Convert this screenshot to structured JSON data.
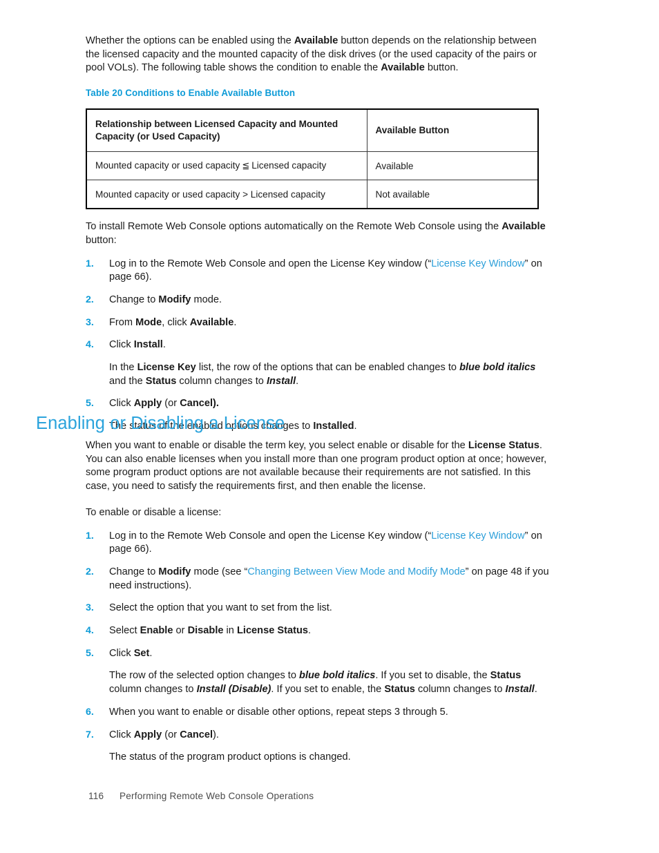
{
  "document": {
    "intro_paragraph": {
      "seg1": "Whether the options can be enabled using the ",
      "bold1": "Available",
      "seg2": " button depends on the relationship between the licensed capacity and the mounted capacity of the disk drives (or the used capacity of the pairs or pool VOLs). The following table shows the condition to enable the ",
      "bold2": "Available",
      "seg3": " button."
    },
    "table_caption": "Table 20 Conditions to Enable Available Button",
    "table": {
      "headers": [
        "Relationship between Licensed Capacity and Mounted Capacity (or Used Capacity)",
        "Available Button"
      ],
      "rows": [
        {
          "condition_pre": "Mounted capacity or used capacity",
          "operator": "≦",
          "condition_post": "Licensed capacity",
          "result": "Available"
        },
        {
          "condition_pre": "Mounted capacity or used capacity > Licensed capacity",
          "operator": "",
          "condition_post": "",
          "result": "Not available"
        }
      ]
    },
    "install_intro": {
      "seg1": "To install Remote Web Console options automatically on the Remote Web Console using the ",
      "bold1": "Available",
      "seg2": " button:"
    },
    "install_steps": [
      {
        "num": "1.",
        "seg1": "Log in to the Remote Web Console and open the License Key window (“",
        "link": "License Key Window",
        "seg2": "” on page 66)."
      },
      {
        "num": "2.",
        "seg1": "Change to ",
        "bold1": "Modify",
        "seg2": " mode."
      },
      {
        "num": "3.",
        "seg1": "From ",
        "bold1": "Mode",
        "seg2": ", click ",
        "bold2": "Available",
        "seg3": "."
      },
      {
        "num": "4.",
        "seg1": "Click ",
        "bold1": "Install",
        "seg2": ".",
        "sub": {
          "s1": "In the ",
          "b1": "License Key",
          "s2": " list, the row of the options that can be enabled changes to ",
          "bi1": "blue bold italics",
          "s3": " and the ",
          "b2": "Status",
          "s4": " column changes to ",
          "bi2": "Install",
          "s5": "."
        }
      },
      {
        "num": "5.",
        "seg1": "Click ",
        "bold1": "Apply",
        "seg2": " (or ",
        "bold2": "Cancel",
        "seg3": ").",
        "sub": {
          "s1": "The status of the enabled options changes to ",
          "b1": "Installed",
          "s2": "."
        }
      }
    ],
    "section_heading": "Enabling or Disabling a License",
    "section_paragraph": {
      "seg1": "When you want to enable or disable the term key, you select enable or disable for the ",
      "bold1": "License Status",
      "seg2": ". You can also enable licenses when you install more than one program product option at once; however, some program product options are not available because their requirements are not satisfied. In this case, you need to satisfy the requirements first, and then enable the license."
    },
    "enable_intro": "To enable or disable a license:",
    "enable_steps": [
      {
        "num": "1.",
        "seg1": "Log in to the Remote Web Console and open the License Key window (“",
        "link": "License Key Window",
        "seg2": "” on page 66)."
      },
      {
        "num": "2.",
        "seg1": "Change to ",
        "bold1": "Modify",
        "seg2": " mode (see “",
        "link": "Changing Between View Mode and Modify Mode",
        "seg3": "” on page 48 if you need instructions)."
      },
      {
        "num": "3.",
        "seg1": "Select the option that you want to set from the list."
      },
      {
        "num": "4.",
        "seg1": "Select ",
        "bold1": "Enable",
        "seg2": " or ",
        "bold2": "Disable",
        "seg3": " in ",
        "bold3": "License Status",
        "seg4": "."
      },
      {
        "num": "5.",
        "seg1": "Click ",
        "bold1": "Set",
        "seg2": ".",
        "sub": {
          "s1": "The row of the selected option changes to ",
          "bi1": "blue bold italics",
          "s2": ". If you set to disable, the ",
          "b1": "Status",
          "s3": " column changes to ",
          "bi2": "Install (Disable)",
          "s4": ". If you set to enable, the ",
          "b2": "Status",
          "s5": " column changes to ",
          "bi3": "Install",
          "s6": "."
        }
      },
      {
        "num": "6.",
        "seg1": "When you want to enable or disable other options, repeat steps 3 through 5."
      },
      {
        "num": "7.",
        "seg1": "Click ",
        "bold1": "Apply",
        "seg2": " (or ",
        "bold2": "Cancel",
        "seg3": ").",
        "sub": {
          "s1": "The status of the program product options is changed."
        }
      }
    ],
    "footer": {
      "page_number": "116",
      "running_title": "Performing Remote Web Console Operations"
    },
    "colors": {
      "heading_blue": "#2ba3dc",
      "caption_blue": "#0d9bd7",
      "link_blue": "#2c9fd9",
      "body_text": "#1c1c1c",
      "footer_text": "#4a4a4a"
    }
  }
}
